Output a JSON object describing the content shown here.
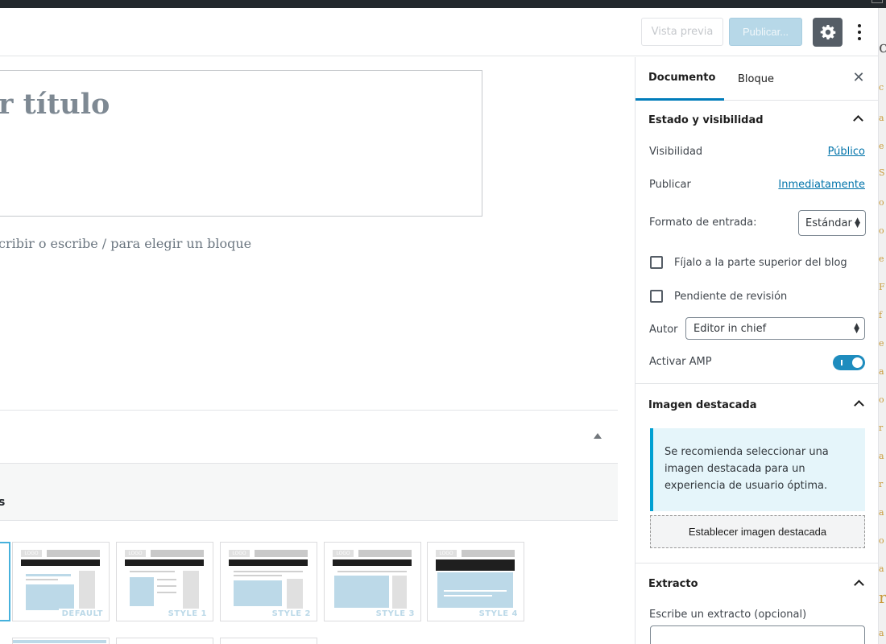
{
  "header": {
    "preview_label": "Vista previa",
    "publish_label": "Publicar...",
    "settings_icon": "gear-icon",
    "more_icon": "vertical-ellipsis-icon"
  },
  "editor": {
    "title_placeholder": "r título",
    "block_hint": "cribir o escribe / para elegir un bloque"
  },
  "meta_box": {
    "subheading": "s",
    "styles": [
      "DEFAULT",
      "STYLE 1",
      "STYLE 2",
      "STYLE 3",
      "STYLE 4"
    ],
    "thumb_logo": "LOGO"
  },
  "sidebar": {
    "tabs": [
      "Documento",
      "Bloque"
    ],
    "close_icon": "close-icon",
    "status": {
      "title": "Estado y visibilidad",
      "visibility_label": "Visibilidad",
      "visibility_value": "Público",
      "publish_label": "Publicar",
      "publish_value": "Inmediatamente",
      "format_label": "Formato de entrada:",
      "format_value": "Estándar",
      "sticky_label": "Fíjalo a la parte superior del blog",
      "pending_label": "Pendiente de revisión",
      "author_label": "Autor",
      "author_value": "Editor in chief",
      "amp_label": "Activar AMP",
      "amp_enabled": true
    },
    "featured": {
      "title": "Imagen destacada",
      "notice": "Se recomienda seleccionar una imagen destacada para un experiencia de usuario óptima.",
      "button": "Establecer imagen destacada"
    },
    "excerpt": {
      "title": "Extracto",
      "label": "Escribe un extracto (opcional)"
    }
  },
  "colors": {
    "accent": "#007cba",
    "toggle_on": "#1e8cbe",
    "notice_border": "#00a0d2",
    "selected_thumb": "#46b1dc"
  }
}
